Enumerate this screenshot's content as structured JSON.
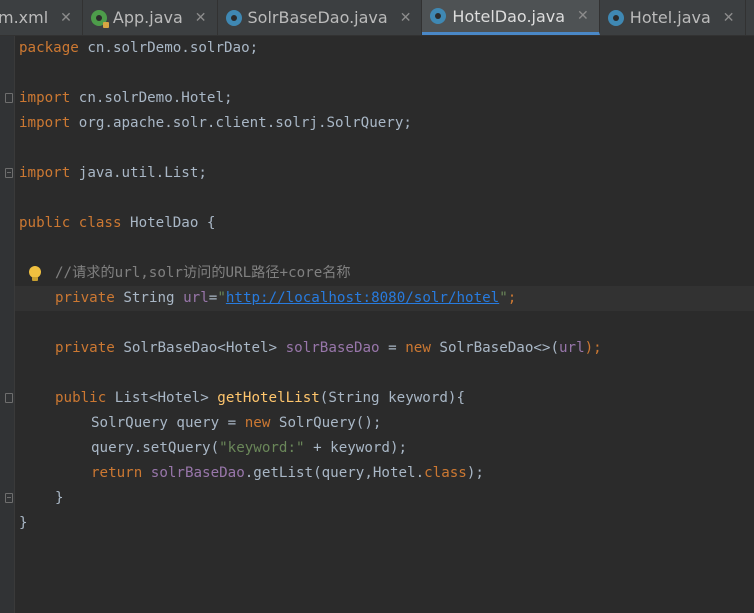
{
  "tabs": [
    {
      "label": "m.xml",
      "icon": "xml-file-icon",
      "active": false
    },
    {
      "label": "App.java",
      "icon": "java-class-run-icon",
      "active": false
    },
    {
      "label": "SolrBaseDao.java",
      "icon": "java-class-icon",
      "active": false
    },
    {
      "label": "HotelDao.java",
      "icon": "java-class-icon",
      "active": true
    },
    {
      "label": "Hotel.java",
      "icon": "java-class-icon",
      "active": false
    }
  ],
  "close_glyph": "✕",
  "code": {
    "l1": {
      "kw": "package",
      "rest": " cn.solrDemo.solrDao;"
    },
    "l3": {
      "kw": "import",
      "rest": " cn.solrDemo.Hotel;"
    },
    "l4": {
      "kw": "import",
      "rest": " org.apache.solr.client.solrj.SolrQuery;"
    },
    "l6": {
      "kw": "import",
      "rest": " java.util.List;"
    },
    "l8": {
      "kw1": "public",
      "kw2": "class",
      "rest": " HotelDao {"
    },
    "l10": {
      "comment": "//请求的url,solr访问的URL路径+core名称"
    },
    "l11": {
      "kw": "private",
      "type": " String ",
      "field": "url",
      "eq": "=",
      "q1": "\"",
      "url": "http://localhost:8080/solr/hotel",
      "q2": "\"",
      "end": ";"
    },
    "l13": {
      "kw": "private",
      "type": " SolrBaseDao<Hotel> ",
      "field": "solrBaseDao",
      "eq": " = ",
      "kw_new": "new",
      "rest": " SolrBaseDao<>(",
      "arg": "url",
      "end": ");"
    },
    "l15": {
      "kw": "public",
      "type": " List<Hotel> ",
      "method": "getHotelList",
      "rest": "(String keyword){"
    },
    "l16": {
      "text": "SolrQuery query = ",
      "kw_new": "new",
      "rest": " SolrQuery();"
    },
    "l17": {
      "text": "query.setQuery(",
      "str": "\"keyword:\"",
      "rest": " + keyword);"
    },
    "l18": {
      "kw": "return",
      "field": "solrBaseDao",
      "rest": ".getList(query,Hotel.",
      "kw2": "class",
      "end": ");"
    },
    "l19": {
      "text": "}"
    },
    "l20": {
      "text": "}"
    }
  },
  "colors": {
    "background": "#2b2b2b",
    "keyword": "#cc7832",
    "string": "#6a8759",
    "field": "#9876aa",
    "method": "#ffc66d",
    "comment": "#808080"
  }
}
